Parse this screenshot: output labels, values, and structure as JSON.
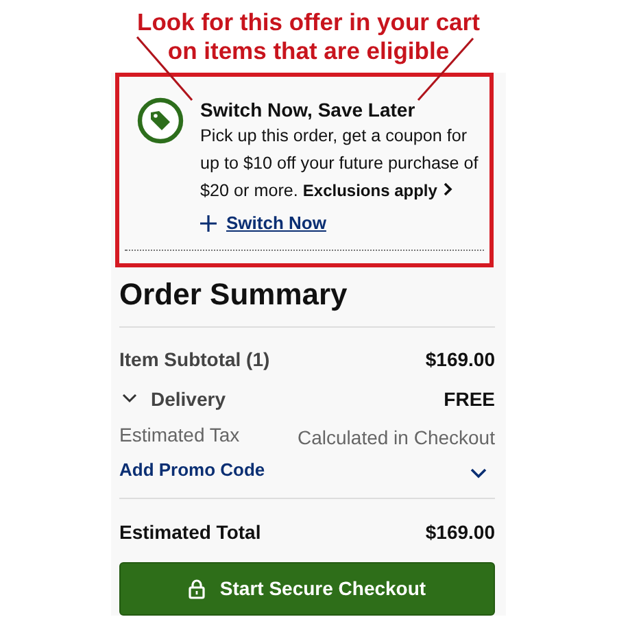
{
  "annotation": {
    "lines": [
      "Look for this offer in your cart",
      "on items that are eligible"
    ]
  },
  "offer": {
    "title": "Switch Now, Save Later",
    "body": "Pick up this order, get a coupon for up to $10 off your future purchase of $20 or more.",
    "exclusions_link": "Exclusions apply",
    "action": "Switch Now"
  },
  "summary": {
    "title": "Order Summary",
    "rows": [
      {
        "kind": "subtotal",
        "label": "Item Subtotal (1)",
        "value": "$169.00"
      },
      {
        "kind": "delivery",
        "label": "Delivery",
        "value": "FREE",
        "expanded": false
      },
      {
        "kind": "tax",
        "label": "Estimated Tax",
        "value": "Calculated in Checkout"
      },
      {
        "kind": "promo",
        "label": "Add Promo Code",
        "expanded": false
      },
      {
        "kind": "total",
        "label": "Estimated Total",
        "value": "$169.00"
      }
    ],
    "checkout_button": "Start Secure Checkout"
  }
}
